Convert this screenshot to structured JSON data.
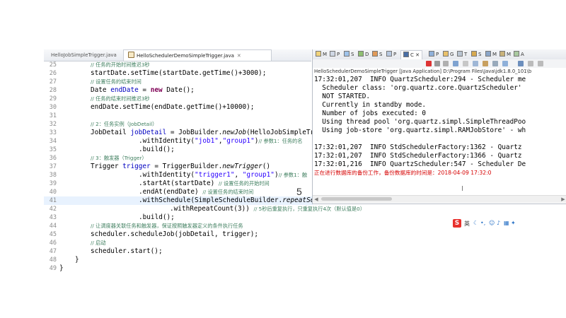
{
  "editor": {
    "tabs": [
      {
        "label": "HelloJobSimpleTrigger.java",
        "active": false
      },
      {
        "label": "HelloSchedulerDemoSimpleTrigger.java",
        "active": true
      }
    ],
    "line_numbers": [
      "25",
      "26",
      "27",
      "28",
      "29",
      "30",
      "31",
      "32",
      "33",
      "34",
      "35",
      "36",
      "37",
      "38",
      "39",
      "40",
      "41",
      "42",
      "43",
      "44",
      "45",
      "46",
      "47",
      "48",
      "49"
    ],
    "code": {
      "l25_comment": "// 任务的开始时间推迟3秒",
      "l26": "startDate.setTime(startDate.getTime()+3000);",
      "l27_comment": "// 设置任务的结束时间",
      "l28_type": "Date ",
      "l28_var": "endDate",
      "l28_eq": " = ",
      "l28_new": "new",
      "l28_rest": " Date();",
      "l29_comment": "// 任务的结束时间推迟3秒",
      "l30": "endDate.setTime(endDate.getTime()+10000);",
      "l32_comment": "// 2：任务实例（JobDetail）",
      "l33_a": "JobDetail ",
      "l33_var": "jobDetail",
      "l33_b": " = JobBuilder.",
      "l33_m": "newJob",
      "l33_c": "(HelloJobSimpleTri",
      "l34_a": ".withIdentity(",
      "l34_s1": "\"job1\"",
      "l34_comma": ",",
      "l34_s2": "\"group1\"",
      "l34_b": ")",
      "l34_comment": "// 参数1：任务的名",
      "l35": ".build();",
      "l36_comment": "// 3：触发器（Trigger）",
      "l37_a": "Trigger ",
      "l37_var": "trigger",
      "l37_b": " = TriggerBuilder.",
      "l37_m": "newTrigger",
      "l37_c": "()",
      "l38_a": ".withIdentity(",
      "l38_s1": "\"trigger1\"",
      "l38_comma": ", ",
      "l38_s2": "\"group1\"",
      "l38_b": ")",
      "l38_comment": "// 参数1：触",
      "l39_a": ".startAt(startDate) ",
      "l39_comment": "// 设置任务的开始时间",
      "l40_a": ".endAt(endDate) ",
      "l40_comment": "// 设置任务的结束时间",
      "l41_a": ".withSchedule(SimpleScheduleBuilder.",
      "l41_m": "repeatSec",
      "l42_a": ".withRepeatCount(3)) ",
      "l42_comment": "// 5秒后重复执行，只重复执行4次（默认值是0）",
      "l43": ".build();",
      "l44_comment": "// 让调度器关联任务和触发器，保证按照触发器定义的条件执行任务",
      "l45": "scheduler.scheduleJob(jobDetail, trigger);",
      "l46_comment": "// 启动",
      "l47": "scheduler.start();",
      "l48": "}",
      "l49": "}"
    }
  },
  "console": {
    "view_tabs": [
      "M",
      "P",
      "S",
      "D",
      "S",
      "P",
      "C",
      "P",
      "G",
      "T",
      "S",
      "M",
      "M",
      "A"
    ],
    "title": "HelloSchedulerDemoSimpleTrigger [Java Application] D:\\Program Files\\Java\\jdk1.8.0_101\\b",
    "lines": [
      "17:32:01,207  INFO QuartzScheduler:294 - Scheduler me",
      "  Scheduler class: 'org.quartz.core.QuartzScheduler'",
      "  NOT STARTED.",
      "  Currently in standby mode.",
      "  Number of jobs executed: 0",
      "  Using thread pool 'org.quartz.simpl.SimpleThreadPoo",
      "  Using job-store 'org.quartz.simpl.RAMJobStore' - wh",
      "",
      "17:32:01,207  INFO StdSchedulerFactory:1362 - Quartz",
      "17:32:01,207  INFO StdSchedulerFactory:1366 - Quartz",
      "17:32:01,216  INFO QuartzScheduler:547 - Scheduler De"
    ],
    "red_line": "正在进行数据库的备份工作，备份数据库的时间是：2018-04-09 17:32:0"
  },
  "overlay_number": "5",
  "ime": {
    "logo": "S",
    "lang": "英"
  },
  "colors": {
    "keyword": "#7f0055",
    "string": "#2a00ff",
    "comment": "#3f7f5f",
    "field": "#0000c0",
    "error_text": "#d60000"
  }
}
